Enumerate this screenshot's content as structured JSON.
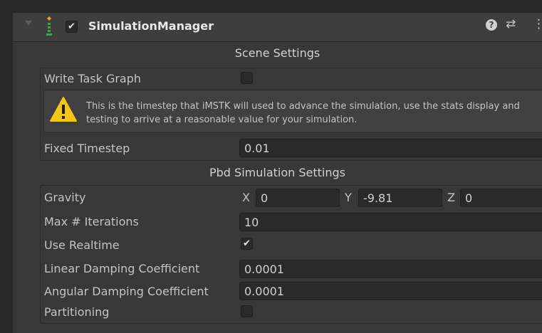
{
  "component": {
    "title": "SimulationManager",
    "enabled": true,
    "help_glyph": "?",
    "presets_glyph": "⇄",
    "menu_glyph": "⋮",
    "script_icon": "script-icon",
    "colors": {
      "warning": "#f5c518",
      "background": "#383838",
      "field": "#2a2a2a"
    }
  },
  "scene_settings": {
    "title": "Scene Settings",
    "write_task_graph": {
      "label": "Write Task Graph",
      "checked": false
    },
    "help_text": "This is the timestep that iMSTK will used to advance the simulation, use the stats display and testing to arrive at a reasonable value for your simulation.",
    "fixed_timestep": {
      "label": "Fixed Timestep",
      "value": "0.01"
    }
  },
  "pbd_settings": {
    "title": "Pbd Simulation Settings",
    "gravity": {
      "label": "Gravity",
      "x_label": "X",
      "x": "0",
      "y_label": "Y",
      "y": "-9.81",
      "z_label": "Z",
      "z": "0"
    },
    "max_iterations": {
      "label": "Max # Iterations",
      "value": "10"
    },
    "use_realtime": {
      "label": "Use Realtime",
      "checked": true,
      "check_glyph": "✔"
    },
    "linear_damping": {
      "label": "Linear Damping Coefficient",
      "value": "0.0001"
    },
    "angular_damping": {
      "label": "Angular Damping Coefficient",
      "value": "0.0001"
    },
    "partitioning": {
      "label": "Partitioning",
      "checked": false
    }
  }
}
